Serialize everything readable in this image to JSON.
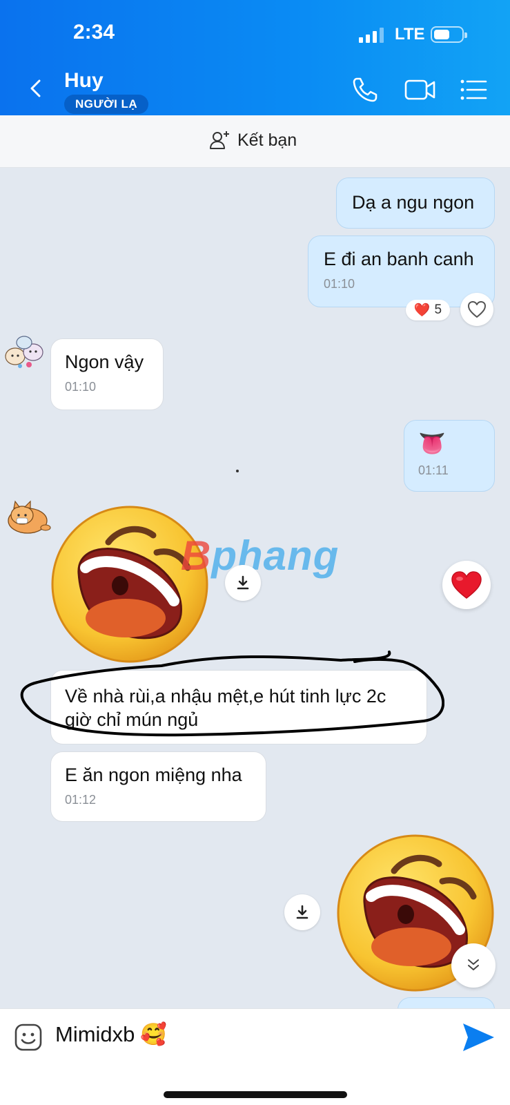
{
  "status_bar": {
    "time": "2:34",
    "network": "LTE"
  },
  "header": {
    "contact_name": "Huy",
    "badge": "NGƯỜI LẠ"
  },
  "friend_bar": {
    "label": "Kết bạn"
  },
  "messages": [
    {
      "side": "sent",
      "text": "Dạ a ngu ngon"
    },
    {
      "side": "sent",
      "text": "E đi an banh canh",
      "time": "01:10"
    },
    {
      "side": "recv",
      "text": "Ngon vậy",
      "time": "01:10"
    },
    {
      "side": "sent",
      "text": "👅",
      "time": "01:11"
    },
    {
      "side": "recv",
      "text": "Về nhà rùi,a nhậu mệt,e hút tinh lực 2c giờ chỉ mún ngủ"
    },
    {
      "side": "recv",
      "text": "E ăn ngon miệng nha",
      "time": "01:12"
    }
  ],
  "reaction": {
    "emoji": "❤️",
    "count": "5"
  },
  "watermark": {
    "first": "B",
    "rest": "phang"
  },
  "composer": {
    "text": "Mimidxb",
    "emoji": "🥰"
  },
  "colors": {
    "header": "#0a80f0",
    "sent_bubble": "#d5ecff",
    "recv_bubble": "#ffffff",
    "accent": "#0a7ef0"
  }
}
